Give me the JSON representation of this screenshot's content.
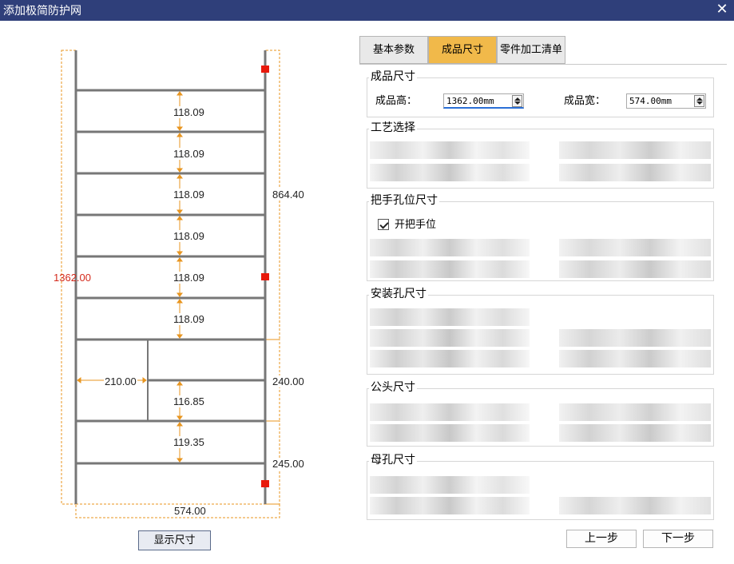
{
  "window": {
    "title": "添加极简防护网",
    "close_icon": "close-icon"
  },
  "drawing": {
    "total_height_label": "1362.00",
    "total_width_label": "574.00",
    "spacing_labels": [
      "118.09",
      "118.09",
      "118.09",
      "118.09",
      "118.09",
      "118.09",
      "116.85",
      "119.35"
    ],
    "right_dimensions": [
      "864.40",
      "240.00",
      "245.00"
    ],
    "inner_width_label": "210.00",
    "accent_color": "#e8951f",
    "marker_color": "#e8190b",
    "total_label_color": "#d42a1c"
  },
  "show_dimensions_button": "显示尺寸",
  "tabs": [
    {
      "label": "基本参数",
      "active": false
    },
    {
      "label": "成品尺寸",
      "active": true
    },
    {
      "label": "零件加工清单",
      "active": false
    }
  ],
  "finished_size": {
    "title": "成品尺寸",
    "height_label": "成品高：",
    "height_value": "1362.00mm",
    "width_label": "成品宽：",
    "width_value": "574.00mm"
  },
  "process_group": {
    "title": "工艺选择"
  },
  "handle_group": {
    "title": "把手孔位尺寸",
    "checkbox_label": "开把手位",
    "checked": true
  },
  "install_group": {
    "title": "安装孔尺寸"
  },
  "male_group": {
    "title": "公头尺寸"
  },
  "female_group": {
    "title": "母孔尺寸"
  },
  "nav": {
    "prev": "上一步",
    "next": "下一步"
  }
}
